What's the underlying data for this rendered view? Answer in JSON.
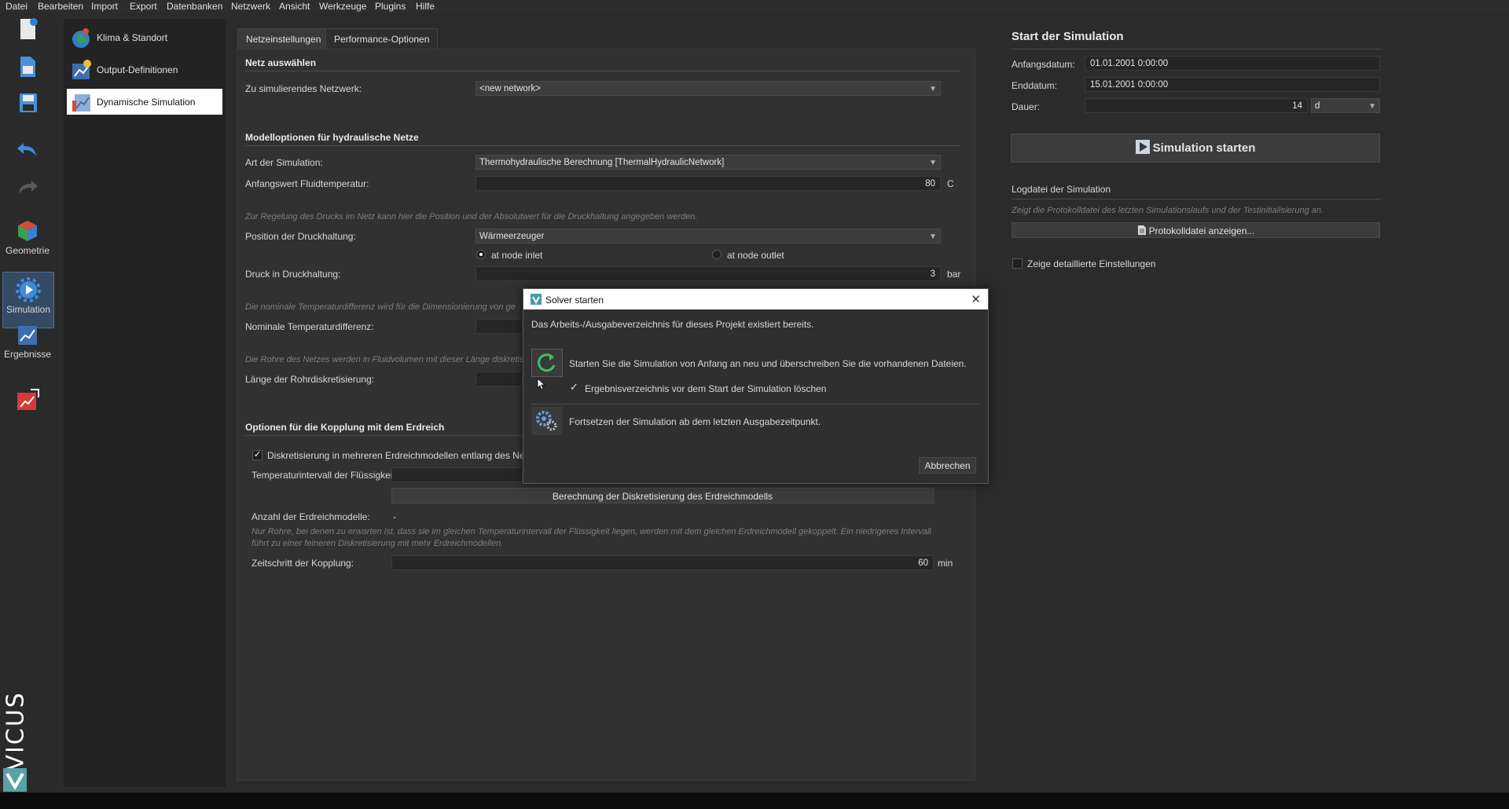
{
  "menu": [
    "Datei",
    "Bearbeiten",
    "Import",
    "Export",
    "Datenbanken",
    "Netzwerk",
    "Ansicht",
    "Werkzeuge",
    "Plugins",
    "Hilfe"
  ],
  "toolbar": {
    "geometry_label": "Geometrie",
    "simulation_label": "Simulation",
    "results_label": "Ergebnisse",
    "brand": "VICUS"
  },
  "nav": {
    "items": [
      {
        "label": "Klima & Standort"
      },
      {
        "label": "Output-Definitionen"
      },
      {
        "label": "Dynamische Simulation"
      }
    ]
  },
  "tabs": [
    "Netzeinstellungen",
    "Performance-Optionen"
  ],
  "net": {
    "section_select": "Netz auswählen",
    "network_label": "Zu simulierendes Netzwerk:",
    "network_value": "<new network>",
    "section_model": "Modelloptionen für hydraulische Netze",
    "sim_type_label": "Art der Simulation:",
    "sim_type_value": "Thermohydraulische Berechnung [ThermalHydraulicNetwork]",
    "fluid_temp_label": "Anfangswert Fluidtemperatur:",
    "fluid_temp_value": "80",
    "fluid_temp_unit": "C",
    "pressure_hint": "Zur Regelung des Drucks im Netz kann hier die Position und der Absolutwert für die Druckhaltung angegeben werden.",
    "pressure_pos_label": "Position der Druckhaltung:",
    "pressure_pos_value": "Wärmeerzeuger",
    "radio_inlet": "at node inlet",
    "radio_outlet": "at node outlet",
    "pressure_label": "Druck in Druckhaltung:",
    "pressure_value": "3",
    "pressure_unit": "bar",
    "temp_diff_hint": "Die nominale Temperaturdifferenz wird für die Dimensionierung von ge",
    "temp_diff_label": "Nominale Temperaturdifferenz:",
    "pipe_hint": "Die Rohre des Netzes werden in Fluidvolumen mit dieser Länge diskretis",
    "pipe_len_label": "Länge der Rohrdiskretisierung:",
    "section_soil": "Optionen für die Kopplung mit dem Erdreich",
    "soil_check_label": "Diskretisierung in mehreren Erdreichmodellen entlang des Netzes",
    "temp_interval_label": "Temperaturintervall der Flüssigkeit:",
    "calc_button": "Berechnung der Diskretisierung des Erdreichmodells",
    "soil_count_label": "Anzahl der Erdreichmodelle:",
    "soil_count_value": "-",
    "soil_hint_1": "Nur Rohre, bei denen zu erwarten ist, dass sie im gleichen Temperaturintervall der Flüssigkeit liegen, werden mit dem gleichen Erdreichmodell gekoppelt. Ein niedrigeres Intervall",
    "soil_hint_2": "führt zu einer feineren Diskretisierung mit mehr Erdreichmodellen.",
    "coupling_label": "Zeitschritt der Kopplung:",
    "coupling_value": "60",
    "coupling_unit": "min"
  },
  "start": {
    "title": "Start der Simulation",
    "start_date_label": "Anfangsdatum:",
    "start_date_value": "01.01.2001  0:00:00",
    "end_date_label": "Enddatum:",
    "end_date_value": "15.01.2001  0:00:00",
    "duration_label": "Dauer:",
    "duration_value": "14",
    "duration_unit": "d",
    "run_button": "Simulation starten",
    "log_title": "Logdatei der Simulation",
    "log_hint": "Zeigt die Protokolldatei des letzten Simulationslaufs und der Testinitialisierung an.",
    "log_button": "Protokolldatei anzeigen...",
    "detail_label": "Zeige detaillierte Einstellungen"
  },
  "dialog": {
    "title": "Solver starten",
    "message": "Das Arbeits-/Ausgabeverzeichnis für dieses Projekt existiert bereits.",
    "restart_text": "Starten Sie die Simulation von Anfang an neu und überschreiben Sie die vorhandenen Dateien.",
    "delete_check_label": "Ergebnisverzeichnis vor dem Start der Simulation löschen",
    "continue_text": "Fortsetzen der Simulation ab dem letzten Ausgabezeitpunkt.",
    "cancel_button": "Abbrechen"
  },
  "colors": {
    "accent": "#4d6f99",
    "background": "#2b2b2b",
    "panel": "#313131"
  }
}
